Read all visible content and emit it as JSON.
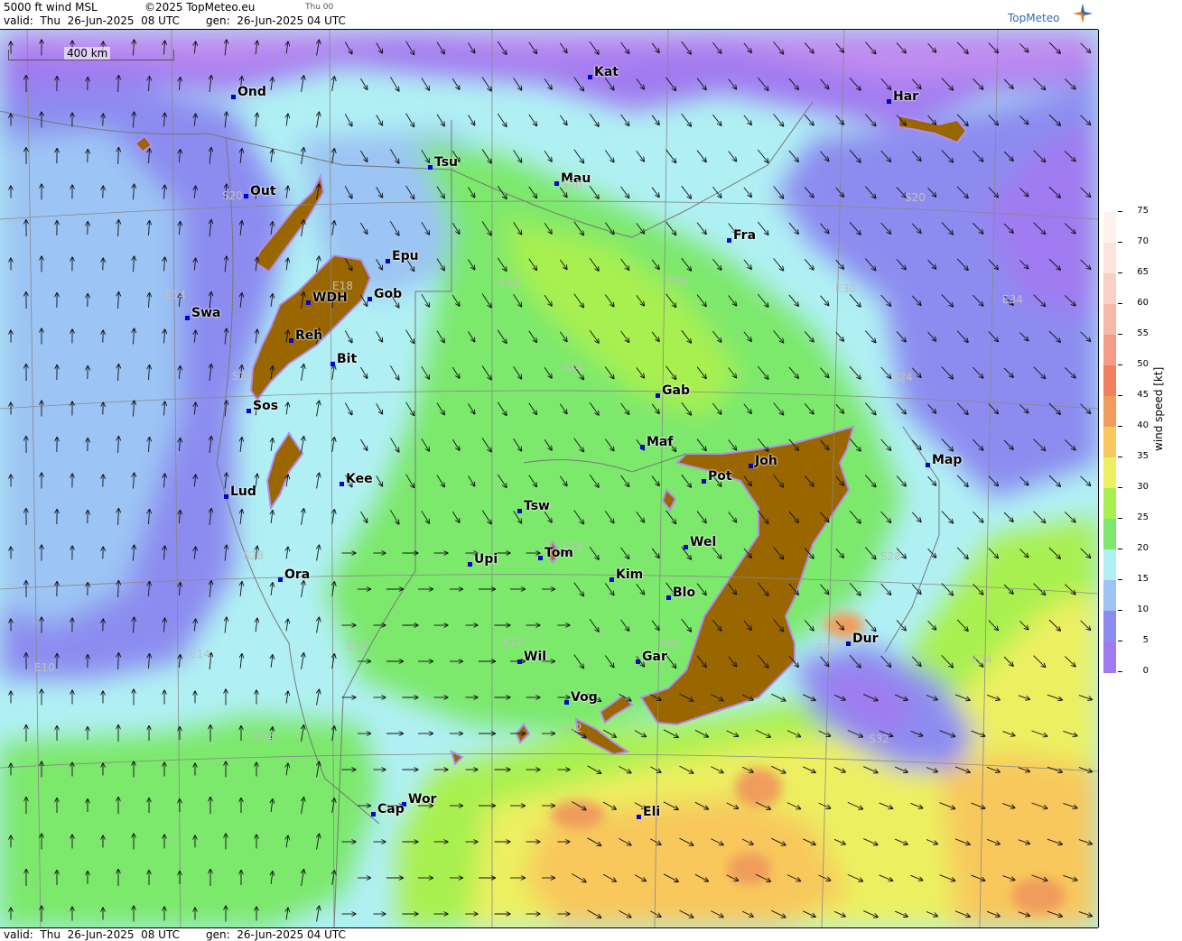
{
  "header": {
    "product": "5000 ft wind MSL",
    "copyright": "©2025 TopMeteo.eu",
    "run_tag": "Thu 00",
    "valid": "valid:  Thu  26-Jun-2025  08 UTC",
    "gen": "gen:  26-Jun-2025 04 UTC",
    "logo": "TopMeteo"
  },
  "footer": {
    "valid": "valid:  Thu  26-Jun-2025  08 UTC",
    "gen": "gen:  26-Jun-2025 04 UTC"
  },
  "scale": {
    "label": "400 km"
  },
  "legend": {
    "title": "wind speed  [kt]",
    "ticks": [
      "75",
      "70",
      "65",
      "60",
      "55",
      "50",
      "45",
      "40",
      "35",
      "30",
      "25",
      "20",
      "15",
      "10",
      "5",
      "0"
    ],
    "colors": {
      "0": "#c08cf0",
      "5": "#a07af0",
      "10": "#8c8cf0",
      "15": "#9cc4f4",
      "20": "#b0f0f4",
      "25": "#7ce86c",
      "30": "#a8f050",
      "35": "#ecf060",
      "40": "#f8c85c",
      "45": "#f09c5c",
      "50": "#f08060",
      "55": "#f49c88",
      "60": "#f8b8a8",
      "65": "#f8d0c4",
      "70": "#fce4dc",
      "75": "#fef2ee"
    },
    "terrain_color": "#996600"
  },
  "cities": [
    {
      "name": "Ond"
    },
    {
      "name": "Kat"
    },
    {
      "name": "Har"
    },
    {
      "name": "Tsu"
    },
    {
      "name": "Mau"
    },
    {
      "name": "Out"
    },
    {
      "name": "Fra"
    },
    {
      "name": "Epu"
    },
    {
      "name": "WDH"
    },
    {
      "name": "Gob"
    },
    {
      "name": "Swa"
    },
    {
      "name": "Reh"
    },
    {
      "name": "Bit"
    },
    {
      "name": "Gab"
    },
    {
      "name": "Sos"
    },
    {
      "name": "Maf"
    },
    {
      "name": "Joh"
    },
    {
      "name": "Map"
    },
    {
      "name": "Pot"
    },
    {
      "name": "Kee"
    },
    {
      "name": "Lud"
    },
    {
      "name": "Tsw"
    },
    {
      "name": "Wel"
    },
    {
      "name": "Tom"
    },
    {
      "name": "Upi"
    },
    {
      "name": "Ora"
    },
    {
      "name": "Kim"
    },
    {
      "name": "Blo"
    },
    {
      "name": "Dur"
    },
    {
      "name": "Wil"
    },
    {
      "name": "Gar"
    },
    {
      "name": "Vog"
    },
    {
      "name": "Wor"
    },
    {
      "name": "Cap"
    },
    {
      "name": "Eli"
    }
  ],
  "grid_labels": [
    "S20",
    "S20",
    "S20",
    "E14",
    "E18",
    "E22",
    "E26",
    "E30",
    "E34",
    "S24",
    "S24",
    "S24",
    "S28",
    "S28",
    "S28",
    "E10",
    "E14",
    "E18",
    "E22",
    "E26",
    "E30",
    "E34",
    "S32",
    "S32",
    "S32"
  ]
}
